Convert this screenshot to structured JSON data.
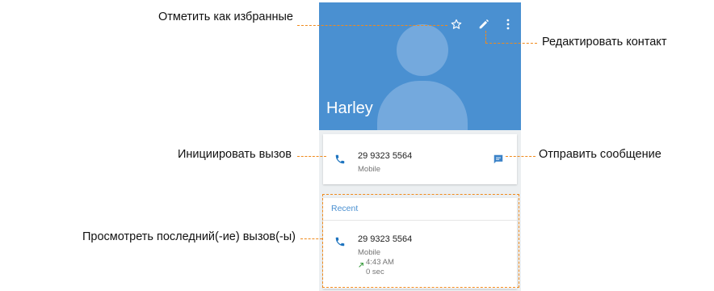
{
  "contact": {
    "name": "Harley",
    "phone_number": "29 9323 5564",
    "phone_type": "Mobile"
  },
  "recent": {
    "title": "Recent",
    "entries": [
      {
        "number": "29 9323 5564",
        "type": "Mobile",
        "time": "4:43 AM",
        "duration": "0 sec"
      }
    ]
  },
  "annotations": {
    "favorite": "Отметить как избранные",
    "edit": "Редактировать контакт",
    "call": "Инициировать вызов",
    "message": "Отправить сообщение",
    "recent": "Просмотреть последний(-ие) вызов(-ы)"
  },
  "icons": {
    "star": "star-outline-icon",
    "edit": "pencil-icon",
    "more": "more-vert-icon",
    "phone": "phone-icon",
    "message": "message-icon",
    "outgoing": "outgoing-call-icon"
  },
  "colors": {
    "header_blue": "#4a90d1",
    "silhouette": "#74a9dd",
    "annotation_orange": "#f08a1c",
    "phone_icon_blue": "#1e74bf",
    "message_icon_blue": "#3b82c8",
    "outgoing_green": "#43a047"
  }
}
